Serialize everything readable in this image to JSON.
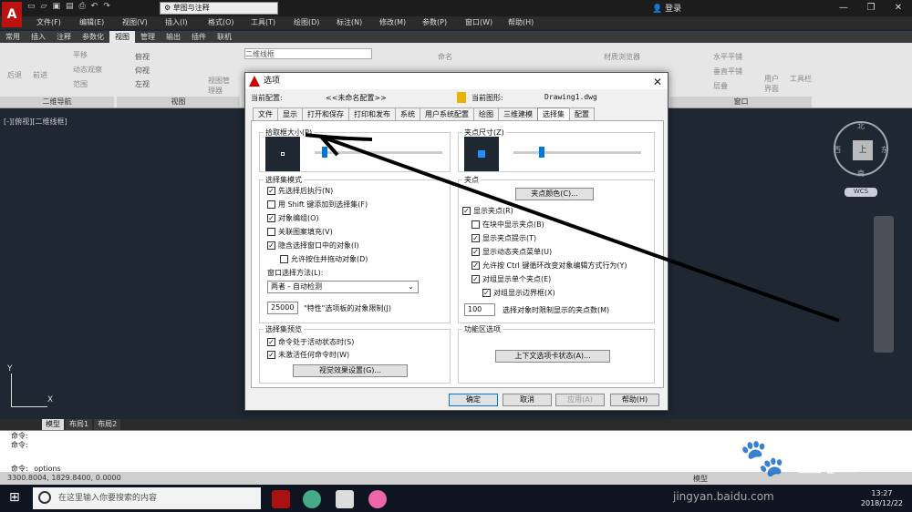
{
  "titlebar": {
    "workspace": "草图与注释",
    "login": "登录",
    "window_buttons": [
      "—",
      "❐",
      "✕"
    ]
  },
  "menubar": {
    "logo": "A",
    "items": [
      "文件(F)",
      "编辑(E)",
      "视图(V)",
      "插入(I)",
      "格式(O)",
      "工具(T)",
      "绘图(D)",
      "标注(N)",
      "修改(M)",
      "参数(P)",
      "窗口(W)",
      "帮助(H)"
    ]
  },
  "ribbon_tabs": [
    "常用",
    "插入",
    "注释",
    "参数化",
    "视图",
    "管理",
    "输出",
    "插件",
    "联机"
  ],
  "ribbon_active_tab": "视图",
  "ribbon": {
    "back": "后退",
    "forward": "前进",
    "pan": "平移",
    "dynamic": "动态观察",
    "range": "范围",
    "nav_panel": "二维导航",
    "views": [
      "俯视",
      "仰视",
      "左视"
    ],
    "view_manager": "视图管理器",
    "view_panel": "视图",
    "visual_style": "二维线框",
    "material_browser": "材质浏览器",
    "tile_h": "水平平铺",
    "tile_v": "垂直平铺",
    "cascade": "层叠",
    "window_panel": "窗口",
    "user_interface": "用户界面",
    "toolbar": "工具栏",
    "name": "命名"
  },
  "viewport_label": "[-][俯视][二维线框]",
  "viewcube": {
    "top": "上",
    "north": "北",
    "south": "南",
    "east": "东",
    "west": "西",
    "wcs": "WCS"
  },
  "ucs": {
    "y": "Y",
    "x": "X"
  },
  "layout_tabs": [
    "模型",
    "布局1",
    "布局2"
  ],
  "command_lines": [
    "命令:",
    "命令:",
    "命令: _options"
  ],
  "status_coords": "3300.8004, 1829.8400, 0.0000",
  "status_model": "模型",
  "taskbar": {
    "search_placeholder": "在这里输入你要搜索的内容",
    "time": "13:27",
    "date": "2018/12/22"
  },
  "watermark": {
    "main": "Bai🐾经验",
    "sub": "jingyan.baidu.com"
  },
  "dialog": {
    "title": "选项",
    "current_profile_label": "当前配置:",
    "current_profile": "<<未命名配置>>",
    "current_drawing_label": "当前图形:",
    "current_drawing": "Drawing1.dwg",
    "tabs": [
      "文件",
      "显示",
      "打开和保存",
      "打印和发布",
      "系统",
      "用户系统配置",
      "绘图",
      "三维建模",
      "选择集",
      "配置"
    ],
    "active_tab": "选择集",
    "pickbox": {
      "title": "拾取框大小(P)",
      "level": 0.2
    },
    "gripsize": {
      "title": "夹点尺寸(Z)",
      "level": 0.25
    },
    "selection_modes": {
      "title": "选择集模式",
      "items": [
        {
          "label": "先选择后执行(N)",
          "checked": true
        },
        {
          "label": "用 Shift 键添加到选择集(F)",
          "checked": false
        },
        {
          "label": "对象编组(O)",
          "checked": true
        },
        {
          "label": "关联图案填充(V)",
          "checked": false
        },
        {
          "label": "隐含选择窗口中的对象(I)",
          "checked": true
        },
        {
          "label": "允许按住并拖动对象(D)",
          "checked": false
        }
      ],
      "window_method_label": "窗口选择方法(L):",
      "window_method": "两者 - 自动检测",
      "limit_value": "25000",
      "limit_label": "\"特性\"选项板的对象限制(J)"
    },
    "preview": {
      "title": "选择集预览",
      "items": [
        {
          "label": "命令处于活动状态时(S)",
          "checked": true
        },
        {
          "label": "未激活任何命令时(W)",
          "checked": true
        }
      ],
      "visual_settings": "视觉效果设置(G)..."
    },
    "grips": {
      "title": "夹点",
      "grip_colors": "夹点颜色(C)...",
      "items": [
        {
          "label": "显示夹点(R)",
          "checked": true
        },
        {
          "label": "在块中显示夹点(B)",
          "checked": false
        },
        {
          "label": "显示夹点提示(T)",
          "checked": true
        },
        {
          "label": "显示动态夹点菜单(U)",
          "checked": true
        },
        {
          "label": "允许按 Ctrl 键循环改变对象编辑方式行为(Y)",
          "checked": true
        },
        {
          "label": "对组显示单个夹点(E)",
          "checked": true
        },
        {
          "label": "对组显示边界框(X)",
          "checked": true
        }
      ],
      "limit_value": "100",
      "limit_label": "选择对象时限制显示的夹点数(M)"
    },
    "ribbon_options": {
      "title": "功能区选项",
      "context_tab": "上下文选项卡状态(A)..."
    },
    "buttons": {
      "ok": "确定",
      "cancel": "取消",
      "apply": "应用(A)",
      "help": "帮助(H)"
    }
  }
}
